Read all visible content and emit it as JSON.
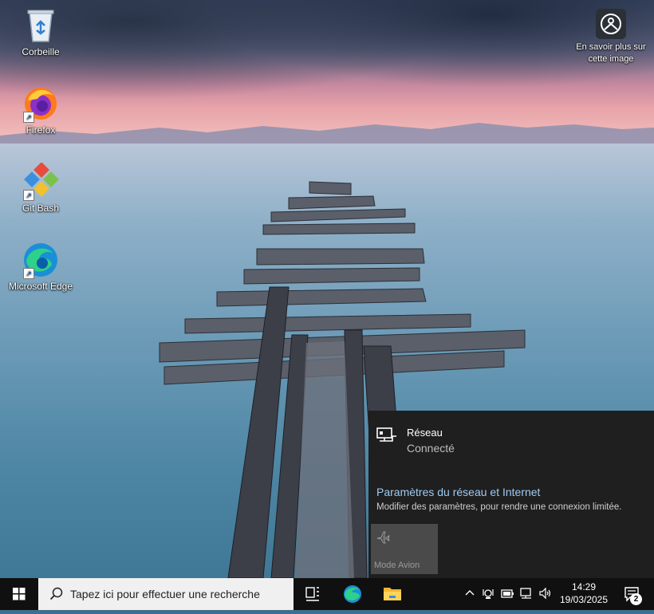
{
  "desktop": {
    "icons": [
      {
        "label": "Corbeille",
        "icon": "recycle-bin-icon"
      },
      {
        "label": "Firefox",
        "icon": "firefox-icon"
      },
      {
        "label": "Git Bash",
        "icon": "git-bash-icon"
      },
      {
        "label": "Microsoft Edge",
        "icon": "edge-icon"
      }
    ],
    "learn_more": {
      "label": "En savoir plus sur cette image",
      "icon": "camera-info-icon"
    }
  },
  "network_flyout": {
    "network_name": "Réseau",
    "network_status": "Connecté",
    "settings_link": "Paramètres du réseau et Internet",
    "settings_description": "Modifier des paramètres, pour rendre une connexion limitée.",
    "airplane_mode_label": "Mode Avion"
  },
  "taskbar": {
    "search_placeholder": "Tapez ici pour effectuer une recherche",
    "time": "14:29",
    "date": "19/03/2025",
    "notification_count": "2",
    "pinned": [
      "task-view-icon",
      "edge-icon",
      "file-explorer-icon"
    ],
    "tray": [
      "chevron-up-icon",
      "camera-icon",
      "battery-icon",
      "network-icon",
      "volume-icon"
    ]
  },
  "colors": {
    "taskbar_bg": "#101010",
    "flyout_bg": "#1f1f1f",
    "link": "#9ecbf2",
    "airplane_tile": "#4a4a4a"
  }
}
